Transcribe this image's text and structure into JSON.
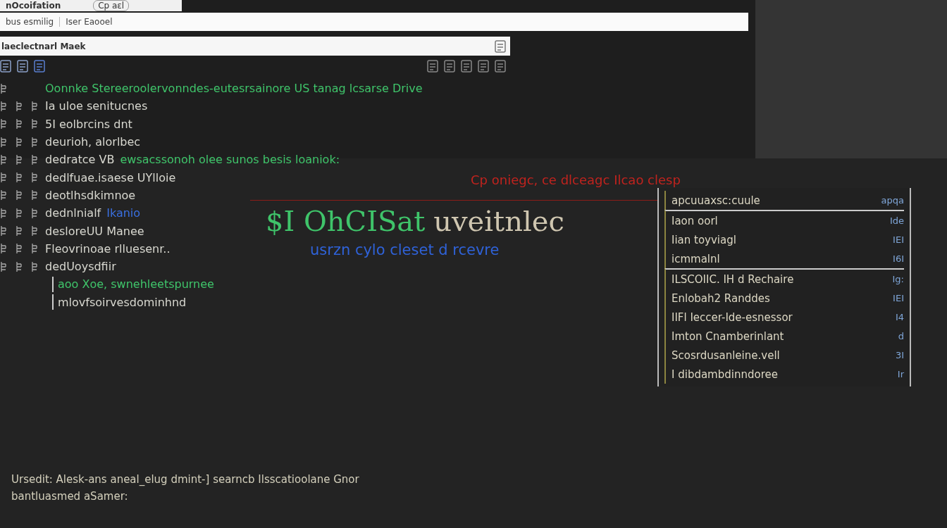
{
  "tabs": [
    {
      "label": "nOcoifation",
      "selected": true
    },
    {
      "label": "Cp aɛl",
      "selected": false
    }
  ],
  "address_bar": {
    "segments": [
      "bus esmilig",
      "Iser Eaooel"
    ]
  },
  "location_bar": {
    "value": "laeclectnarl Maek"
  },
  "terminal": {
    "lines": [
      {
        "kind": "header",
        "parts": [
          {
            "text": "Oonnke Stereeroolervonndes-eutesrsainore  US tanag lcsarse  Drive",
            "color": "#3fc46a"
          }
        ]
      },
      {
        "kind": "entry",
        "parts": [
          {
            "text": "Ia uloe senitucnes",
            "color": "#d8d8d0"
          }
        ]
      },
      {
        "kind": "entry",
        "parts": [
          {
            "text": "5I eolbrcins dnt",
            "color": "#d8d8d0"
          }
        ]
      },
      {
        "kind": "entry",
        "parts": [
          {
            "text": "deurioh, alorlbec",
            "color": "#d8d8d0"
          }
        ]
      },
      {
        "kind": "entry",
        "parts": [
          {
            "text": "dedratce VB",
            "color": "#d8d8d0"
          },
          {
            "text": "ewsacssonoh olee sunos besis loaniok:",
            "color": "#3fc46a"
          }
        ]
      },
      {
        "kind": "entry",
        "parts": [
          {
            "text": "dedlfuae.isaese UYlloie",
            "color": "#d8d8d0"
          }
        ]
      },
      {
        "kind": "entry",
        "parts": [
          {
            "text": "deotlhsdkimnoe",
            "color": "#d8d8d0"
          }
        ]
      },
      {
        "kind": "entry",
        "parts": [
          {
            "text": "dednlnialf",
            "color": "#d8d8d0"
          },
          {
            "text": "Ikanio",
            "color": "#3a6fe0"
          }
        ]
      },
      {
        "kind": "entry",
        "parts": [
          {
            "text": "desloreUU Manee",
            "color": "#d8d8d0"
          }
        ]
      },
      {
        "kind": "entry",
        "parts": [
          {
            "text": "Fleovrinoae rlluesenr..",
            "color": "#d8d8d0"
          }
        ]
      },
      {
        "kind": "entry",
        "parts": [
          {
            "text": "dedUoysdfiir",
            "color": "#d8d8d0"
          }
        ]
      },
      {
        "kind": "note",
        "parts": [
          {
            "text": "aoo Xoe, swnehleetspurnee",
            "color": "#3fc46a"
          }
        ]
      },
      {
        "kind": "note",
        "parts": [
          {
            "text": "mlovfsoirvesdominhnd",
            "color": "#d8d8d0"
          }
        ]
      }
    ]
  },
  "overlay": {
    "heading": "Cp oniegc, ce dlceagc Ilcao clesp",
    "title_parts": [
      {
        "text": "$I OhCISat",
        "color": "#3fc46a"
      },
      {
        "text": "uveitnlec",
        "color": "#cfc6b0"
      }
    ],
    "subtitle": "usrzn cylo cleset d rcevre",
    "diagram": {
      "rows": [
        {
          "label": "apcuuaxsc:cuule",
          "tag": "apqa"
        },
        {
          "label": "Iaon oorl",
          "tag": "Ide"
        },
        {
          "label": "Iian toyviagl",
          "tag": "IEI"
        },
        {
          "label": "icmmalnl",
          "tag": "I6I"
        },
        {
          "label": "ILSCOIIC. IH d Rechaire",
          "tag": "Ig:"
        },
        {
          "label": "Enlobah2 Randdes",
          "tag": "IEI"
        },
        {
          "label": "IIFl Ieccer-Ide-esnessor",
          "tag": "I4"
        },
        {
          "label": "Imton Cnamberinlant",
          "tag": "d"
        },
        {
          "label": "Scosrdusanleine.vell",
          "tag": "3I"
        },
        {
          "label": "I dibdambdinndoree",
          "tag": "Ir"
        }
      ]
    }
  },
  "footer": {
    "lines": [
      "Ursedit: Alesk-ans aneal_elug dmint-] searncb Ilsscatioolane Gnor",
      "bantluasmed aSamer:"
    ]
  }
}
